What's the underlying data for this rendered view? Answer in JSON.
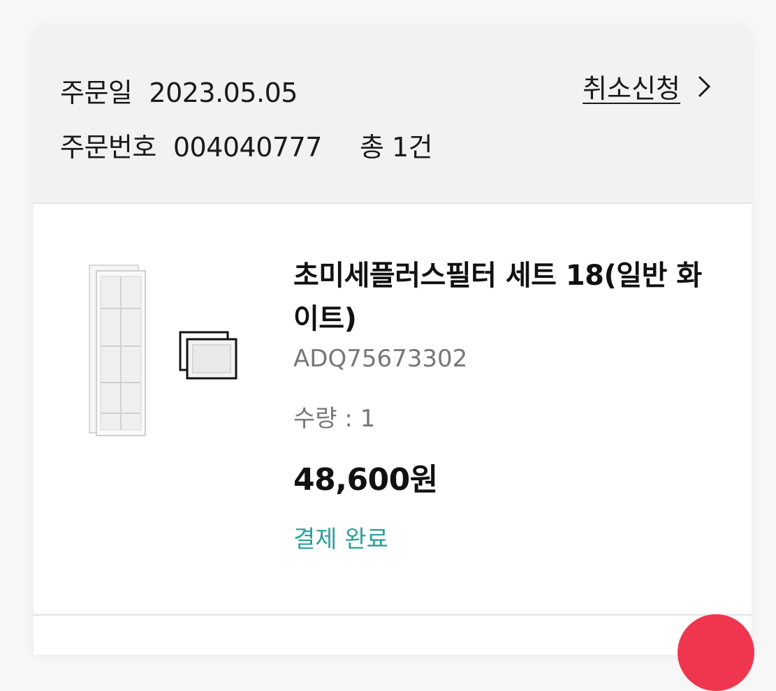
{
  "order": {
    "date_label": "주문일",
    "date_value": "2023.05.05",
    "number_label": "주문번호",
    "number_value": "004040777",
    "total_count": "총 1건",
    "cancel_label": "취소신청"
  },
  "product": {
    "name": "초미세플러스필터 세트 18(일반 화이트)",
    "sku": "ADQ75673302",
    "quantity": "수량 : 1",
    "price": "48,600원",
    "status": "결제 완료"
  },
  "colors": {
    "header_bg": "#f2f2f2",
    "status_teal": "#2ea09a",
    "fab_red": "#f0364f"
  },
  "icons": {
    "cancel_chevron": "chevron-right-icon",
    "fab": "floating-action-button"
  }
}
